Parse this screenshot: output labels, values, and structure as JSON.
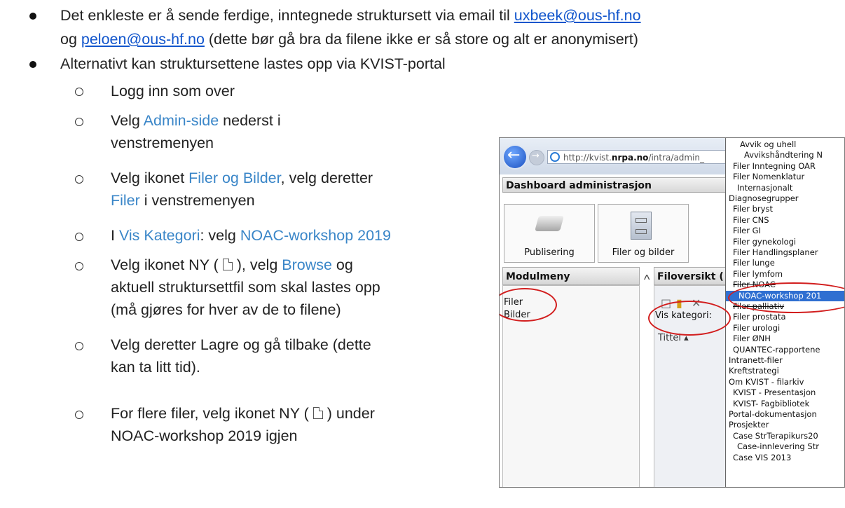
{
  "bullets": [
    {
      "line1_text": "Det enkleste er å sende ferdige, inntegnede struktursett via email til ",
      "line1_link": "uxbeek@ous-hf.no",
      "line2_pre": "og ",
      "line2_link": "peloen@ous-hf.no",
      "line2_text": " (dette bør gå bra da filene ikke er så store og alt er anonymisert)"
    },
    {
      "text": "Alternativt kan struktursettene lastes opp via KVIST-portal"
    }
  ],
  "steps": {
    "s1": "Logg inn som over",
    "s2_a": "Velg ",
    "s2_hl": "Admin-side",
    "s2_b": " nederst i",
    "s2_c": "venstremenyen",
    "s3_a": "Velg ikonet ",
    "s3_hl": "Filer og Bilder",
    "s3_b": ", velg deretter",
    "s3_hl2": "Filer",
    "s3_c": " i venstremenyen",
    "s4_a": "I ",
    "s4_hl": "Vis Kategori",
    "s4_b": ": velg ",
    "s4_hl2": "NOAC-workshop 2019",
    "s5_a": "Velg ikonet NY ( ",
    "s5_b": " ), velg ",
    "s5_hl": "Browse",
    "s5_c": " og",
    "s5_d": "aktuell struktursettfil som skal lastes opp",
    "s5_e": "(må gjøres for hver av de to filene)",
    "s6_a": "Velg deretter Lagre og gå tilbake (dette",
    "s6_b": "kan ta litt tid).",
    "s7_a": "For flere filer, velg ikonet NY ( ",
    "s7_b": " ) under",
    "s7_c": "NOAC-workshop 2019 igjen"
  },
  "screenshot": {
    "url_pre": "http://kvist.",
    "url_bold": "nrpa.no",
    "url_post": "/intra/admin_",
    "dashboard_title": "Dashboard administrasjon",
    "tile1": "Publisering",
    "tile2": "Filer og bilder",
    "modulmeny": "Modulmeny",
    "filoversikt": "Filoversikt (",
    "mod_items": [
      "Filer",
      "Bilder"
    ],
    "vis_kategori": "Vis kategori:",
    "tittel": "Tittel ▴",
    "dropdown": [
      "Avvik og uhell",
      "Avvikshåndtering N",
      "Filer Inntegning OAR",
      "Filer Nomenklatur",
      "Internasjonalt",
      "Diagnosegrupper",
      "Filer bryst",
      "Filer CNS",
      "Filer GI",
      "Filer gynekologi",
      "Filer Handlingsplaner",
      "Filer lunge",
      "Filer lymfom",
      "Filer NOAC",
      "NOAC-workshop 201",
      "Filer palliativ",
      "Filer prostata",
      "Filer urologi",
      "Filer ØNH",
      "QUANTEC-rapportene",
      "Intranett-filer",
      "Kreftstrategi",
      "Om KVIST - filarkiv",
      "KVIST - Presentasjon",
      "KVIST- Fagbibliotek",
      "Portal-dokumentasjon",
      "Prosjekter",
      "Case StrTerapikurs20",
      "Case-innlevering Str",
      "Case VIS 2013"
    ]
  }
}
